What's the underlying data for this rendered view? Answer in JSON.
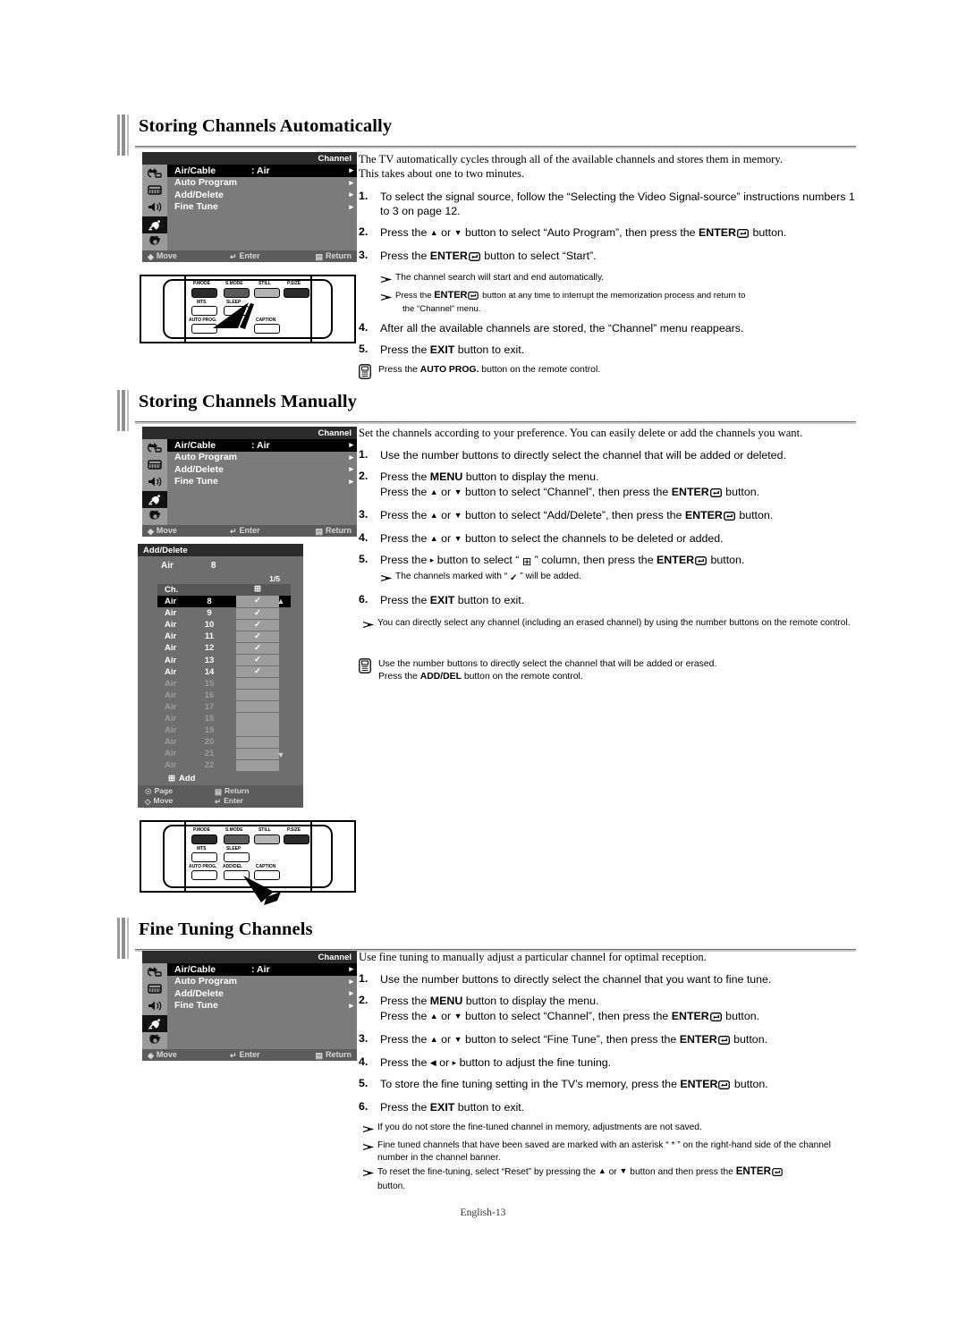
{
  "page": {
    "footer": "English-13"
  },
  "sections": [
    {
      "id": "storing-automatically",
      "title": "Storing Channels Automatically",
      "intro_line1": "The TV automatically cycles through all of the available channels and stores them in memory.",
      "intro_line2": "This takes about one to two minutes.",
      "steps": [
        {
          "num": "1.",
          "text": "To select the signal source, follow the “Selecting the Video Signal-source” instructions numbers 1 to 3 on page 12."
        },
        {
          "num": "2.",
          "text": "Press the ▴ or ▾ button to select “Auto Program”, then press the ENTER ⮐ button."
        },
        {
          "num": "3.",
          "text": "Press the ENTER ⮐ button to select “Start”."
        },
        {
          "num": "4.",
          "text": "After all the available channels are stored, the “Channel” menu reappears."
        },
        {
          "num": "5.",
          "text": "Press the EXIT button to exit."
        }
      ],
      "bullets": [
        "The channel search will start and end automatically.",
        "Press the ENTER ⮐ button at any time to interrupt the memorization process and return to the “Channel” menu."
      ],
      "note": "Press the AUTO PROG. button on the remote control."
    },
    {
      "id": "storing-manually",
      "title": "Storing Channels Manually",
      "intro_line1": "Set the channels according to your preference. You can easily delete or add the channels you want.",
      "intro_line2": "",
      "steps": [
        {
          "num": "1.",
          "text": "Use the number buttons to directly select the channel that will be added or deleted."
        },
        {
          "num": "2.",
          "text": "Press the MENU button to display the menu. Press the ▴ or ▾ button to select “Channel”, then press the ENTER ⮐ button."
        },
        {
          "num": "3.",
          "text": "Press the ▴ or ▾ button to select “Add/Delete”, then press the ENTER ⮐ button."
        },
        {
          "num": "4.",
          "text": "Press the ▴ or ▾ button to select the channels to be deleted or added."
        },
        {
          "num": "5.",
          "text": "Press the ▸ button to select “ ⊞ ” column, then press the ENTER ⮐ button."
        },
        {
          "num": "6.",
          "text": "Press the EXIT button to exit."
        }
      ],
      "bullets": [
        "The channels marked with “ ✔ ” will be added.",
        "You can directly select any channel (including an erased channel) by using the number buttons on the remote control."
      ],
      "note": "Use the number buttons to directly select the channel that will be added or erased. Press the ADD/DEL button on the remote control."
    },
    {
      "id": "fine-tuning",
      "title": "Fine Tuning Channels",
      "intro_line1": "Use fine tuning to manually adjust a particular channel for optimal reception.",
      "intro_line2": "",
      "steps": [
        {
          "num": "1.",
          "text": "Use the number buttons to directly select the channel that you want to fine tune."
        },
        {
          "num": "2.",
          "text": "Press the MENU button to display the menu. Press the ▴ or ▾ button to select “Channel”, then press the ENTER ⮐ button."
        },
        {
          "num": "3.",
          "text": "Press the ▴ or ▾ button to select “Fine Tune”, then press the ENTER ⮐ button."
        },
        {
          "num": "4.",
          "text": "Press the ◂ or ▸ button to adjust the fine tuning."
        },
        {
          "num": "5.",
          "text": "To store the fine tuning setting in the TV’s memory, press the ENTER ⮐ button."
        },
        {
          "num": "6.",
          "text": "Press the EXIT button to exit."
        }
      ],
      "bullets": [
        "If you do not store the fine-tuned channel in memory, adjustments are not saved.",
        "Fine tuned channels that have been saved are marked with an asterisk “ * ” on the right-hand side of the channel number in the channel banner.",
        "To reset the fine-tuning, select “Reset” by pressing the ▴ or ▾ button and then press the ENTER ⮐ button."
      ],
      "note": ""
    }
  ],
  "osd_menu": {
    "title": "Channel",
    "rail_icons": [
      "input-source-icon",
      "picture-icon",
      "sound-icon",
      "channel-dish-icon",
      "setup-gear-icon"
    ],
    "rail_active_index": 3,
    "items": [
      {
        "label": "Air/Cable",
        "value": ": Air",
        "arrow": "▸",
        "selected": true
      },
      {
        "label": "Auto Program",
        "value": "",
        "arrow": "▸",
        "selected": false
      },
      {
        "label": "Add/Delete",
        "value": "",
        "arrow": "▸",
        "selected": false
      },
      {
        "label": "Fine Tune",
        "value": "",
        "arrow": "▸",
        "selected": false
      }
    ],
    "footer": {
      "move": "Move",
      "enter": "Enter",
      "return": "Return"
    }
  },
  "add_delete_panel": {
    "title": "Add/Delete",
    "current": {
      "band": "Air",
      "channel": "8"
    },
    "page_indicator": "1/5",
    "header": {
      "ch_label": "Ch.",
      "add_column_icon": "⊞"
    },
    "rows": [
      {
        "band": "Air",
        "num": "8",
        "checked": true,
        "selected": true
      },
      {
        "band": "Air",
        "num": "9",
        "checked": true,
        "selected": false
      },
      {
        "band": "Air",
        "num": "10",
        "checked": true,
        "selected": false
      },
      {
        "band": "Air",
        "num": "11",
        "checked": true,
        "selected": false
      },
      {
        "band": "Air",
        "num": "12",
        "checked": true,
        "selected": false
      },
      {
        "band": "Air",
        "num": "13",
        "checked": true,
        "selected": false
      },
      {
        "band": "Air",
        "num": "14",
        "checked": true,
        "selected": false
      },
      {
        "band": "Air",
        "num": "15",
        "checked": false,
        "selected": false
      },
      {
        "band": "Air",
        "num": "16",
        "checked": false,
        "selected": false
      },
      {
        "band": "Air",
        "num": "17",
        "checked": false,
        "selected": false
      },
      {
        "band": "Air",
        "num": "18",
        "checked": false,
        "selected": false
      },
      {
        "band": "Air",
        "num": "19",
        "checked": false,
        "selected": false
      },
      {
        "band": "Air",
        "num": "20",
        "checked": false,
        "selected": false
      },
      {
        "band": "Air",
        "num": "21",
        "checked": false,
        "selected": false
      },
      {
        "band": "Air",
        "num": "22",
        "checked": false,
        "selected": false
      }
    ],
    "add_label": "Add",
    "footer": {
      "page": "Page",
      "move": "Move",
      "ret": "Return",
      "enter": "Enter"
    }
  },
  "remote_auto": {
    "buttons_row1": [
      "P.MODE",
      "S.MODE",
      "STILL",
      "P.SIZE"
    ],
    "buttons_row2": [
      "MTS",
      "SLEEP"
    ],
    "buttons_row3": [
      "AUTO PROG.",
      "CAPTION"
    ],
    "pointer_target": "AUTO PROG."
  },
  "remote_adddel": {
    "buttons_row1": [
      "P.MODE",
      "S.MODE",
      "STILL",
      "P.SIZE"
    ],
    "buttons_row2": [
      "MTS",
      "SLEEP"
    ],
    "buttons_row3": [
      "AUTO PROG.",
      "ADD/DEL",
      "CAPTION"
    ],
    "pointer_target": "ADD/DEL"
  },
  "colors": {
    "osd_bg": "#7b7b7b",
    "osd_title_bg": "#2b2b2b",
    "osd_selected": "#000000",
    "osd_rail": "#9a9a9a",
    "osd_footer": "#5c5c5c",
    "add_column": "#9d9d9d",
    "page_bg": "#ffffff",
    "text": "#000000"
  }
}
